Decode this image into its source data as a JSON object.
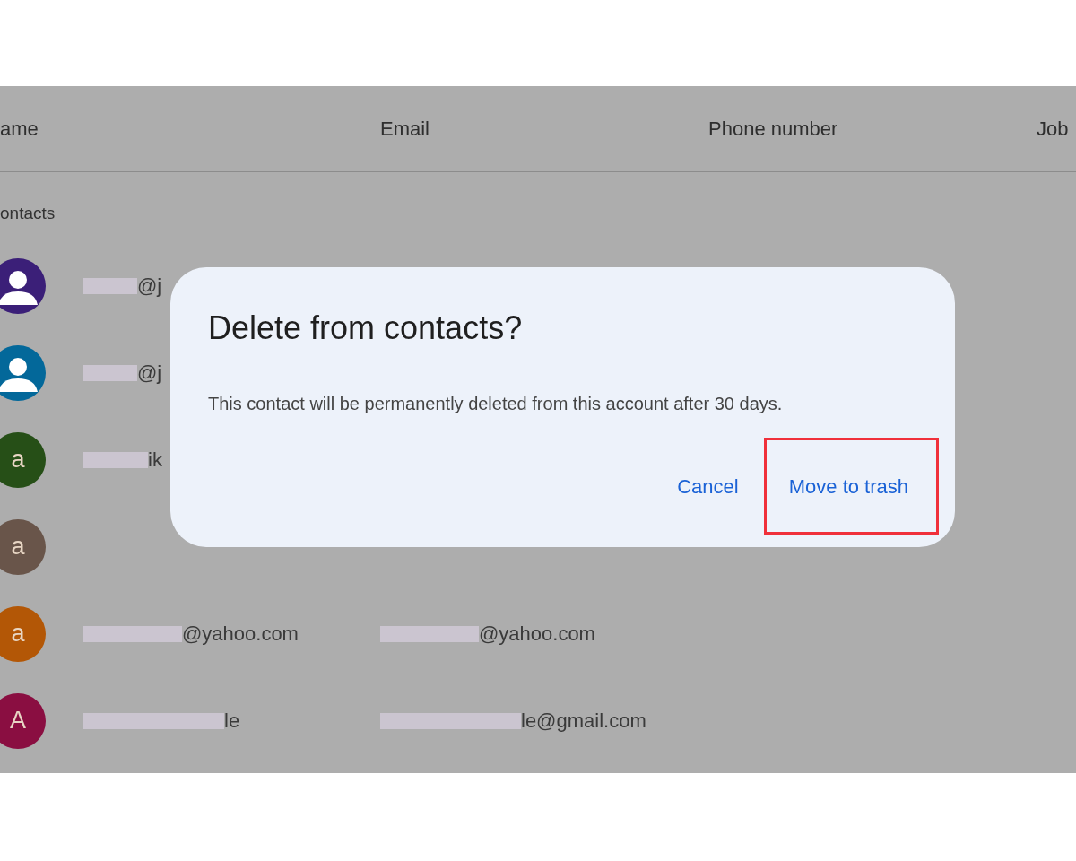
{
  "table": {
    "columns": [
      "ame",
      "Email",
      "Phone number",
      "Job"
    ],
    "section_label": "ontacts",
    "rows": [
      {
        "avatar": {
          "kind": "person",
          "color": "#3b1f78"
        },
        "name": "@j",
        "name_redacted": true
      },
      {
        "avatar": {
          "kind": "person",
          "color": "#03689a"
        },
        "name": "@j",
        "name_redacted": true
      },
      {
        "avatar": {
          "kind": "letter",
          "letter": "a",
          "color": "#264f17"
        },
        "name": "ik",
        "name_redacted": true
      },
      {
        "avatar": {
          "kind": "letter",
          "letter": "a",
          "color": "#69554a"
        }
      },
      {
        "avatar": {
          "kind": "letter",
          "letter": "a",
          "color": "#b35706"
        },
        "name": "@yahoo.com",
        "name_redacted": true,
        "email": "@yahoo.com",
        "email_redacted": true
      },
      {
        "avatar": {
          "kind": "letter",
          "letter": "A",
          "color": "#8a0e41"
        },
        "name": "le",
        "name_redacted": true,
        "email": "le@gmail.com",
        "email_redacted": true
      }
    ]
  },
  "dialog": {
    "title": "Delete from contacts?",
    "message": "This contact will be permanently deleted from this account after 30 days.",
    "buttons": [
      {
        "label": "Cancel",
        "highlighted": false
      },
      {
        "label": "Move to trash",
        "highlighted": true
      }
    ]
  }
}
